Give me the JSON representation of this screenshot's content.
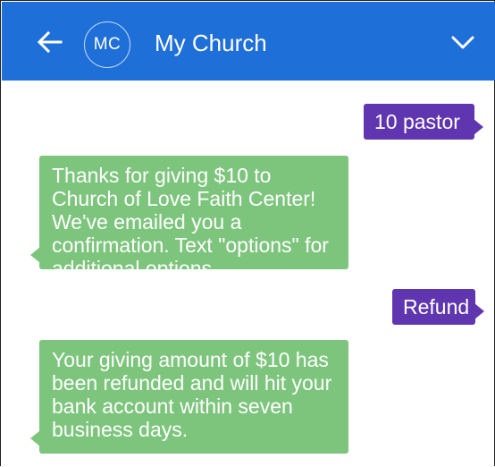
{
  "header": {
    "back_icon": "arrow-left-icon",
    "avatar_initials": "MC",
    "title": "My Church",
    "menu_icon": "chevron-down-icon",
    "background_color": "#1f6fd9"
  },
  "messages": [
    {
      "direction": "outgoing",
      "text": "10 pastor",
      "color": "#6036b0"
    },
    {
      "direction": "incoming",
      "text": "Thanks for giving $10 to Church of Love Faith Center! We've emailed you a confirmation. Text \"options\" for additional options.",
      "color": "#7dc57d"
    },
    {
      "direction": "outgoing",
      "text": "Refund",
      "color": "#6036b0"
    },
    {
      "direction": "incoming",
      "text": "Your giving amount of $10 has been refunded and will hit your bank account within seven business days.",
      "color": "#7dc57d"
    }
  ]
}
